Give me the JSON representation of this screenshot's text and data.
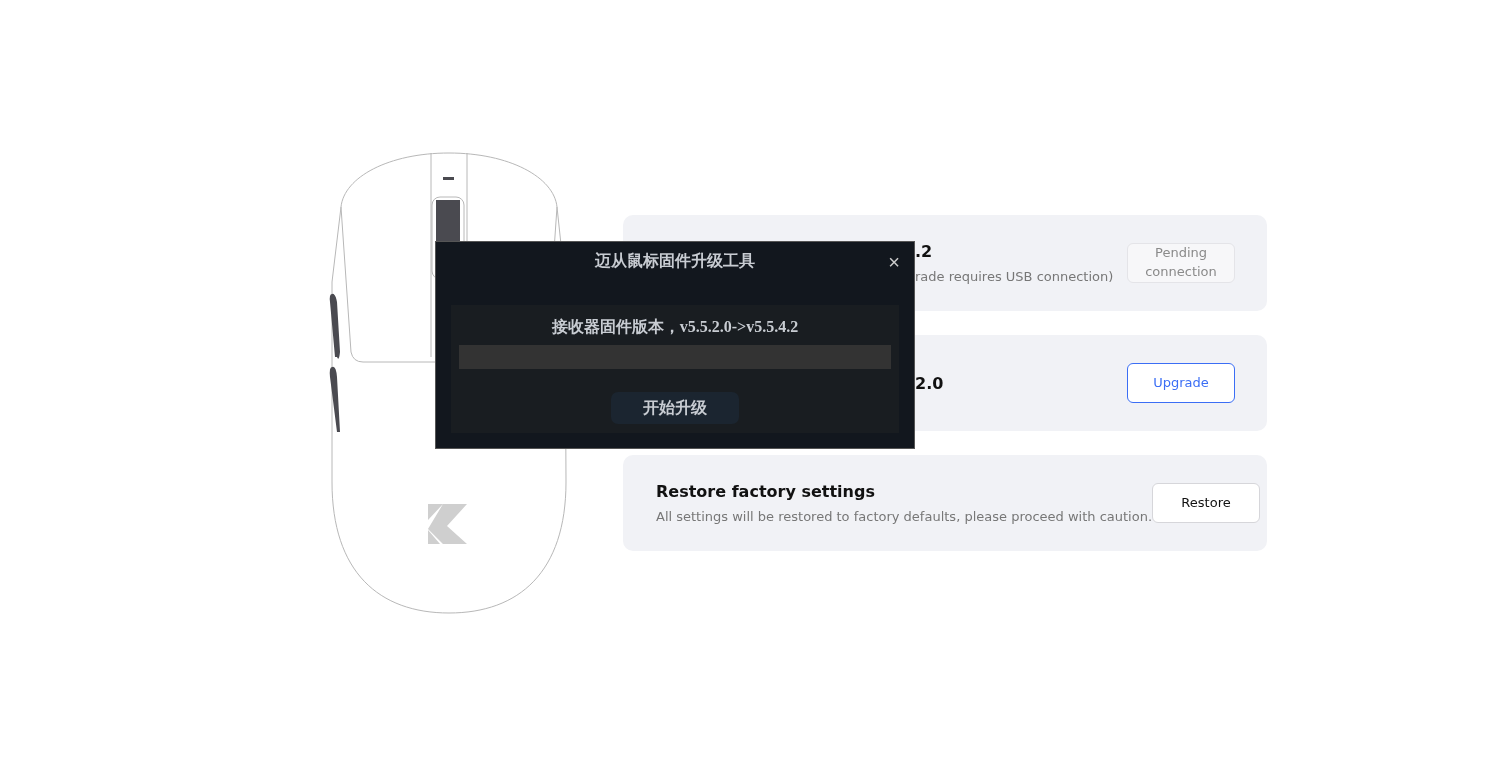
{
  "cards": [
    {
      "title": ".2",
      "description": "rade requires USB connection)",
      "button": {
        "label": "Pending connection",
        "kind": "disabled"
      }
    },
    {
      "title": "2.0",
      "button": {
        "label": "Upgrade",
        "kind": "primary"
      }
    },
    {
      "title": "Restore factory settings",
      "description": "All settings will be restored to factory defaults, please proceed with caution.",
      "button": {
        "label": "Restore",
        "kind": "default"
      }
    }
  ],
  "dialog": {
    "title": "迈从鼠标固件升级工具",
    "close": "×",
    "message": "接收器固件版本，v5.5.2.0->v5.5.4.2",
    "progress": {
      "level": 0
    },
    "button": "开始升级"
  }
}
